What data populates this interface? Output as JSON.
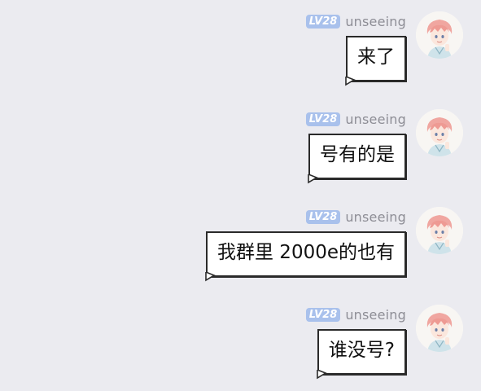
{
  "messages": [
    {
      "username": "unseeing",
      "level_label": "LV28",
      "text": "来了"
    },
    {
      "username": "unseeing",
      "level_label": "LV28",
      "text": "号有的是"
    },
    {
      "username": "unseeing",
      "level_label": "LV28",
      "text": "我群里 2000e的也有"
    },
    {
      "username": "unseeing",
      "level_label": "LV28",
      "text": "谁没号?"
    }
  ],
  "colors": {
    "background": "#ebebf0",
    "level_badge": "#a9c1ec",
    "username": "#8d8d95",
    "bubble_border": "#2a2a2a"
  },
  "icons": {
    "avatar": "anime-avatar-icon"
  }
}
